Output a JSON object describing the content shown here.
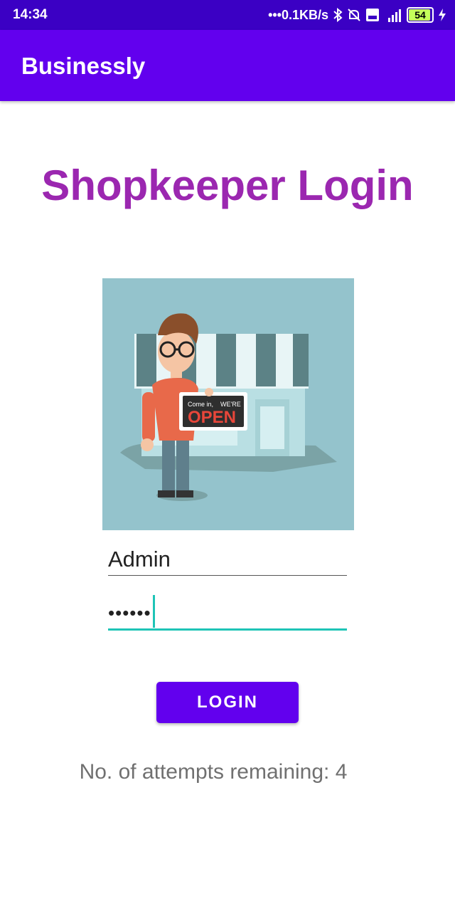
{
  "status_bar": {
    "time": "14:34",
    "network_speed": "•••0.1KB/s",
    "battery": "54",
    "icons": [
      "bluetooth-icon",
      "silent-icon",
      "volte-icon",
      "signal-4g-icon",
      "battery-icon",
      "charging-icon"
    ]
  },
  "app_bar": {
    "title": "Businessly"
  },
  "login": {
    "heading": "Shopkeeper Login",
    "illustration": {
      "sign_small_left": "Come in,",
      "sign_small_right": "WE'RE",
      "sign_big": "OPEN"
    },
    "username_value": "Admin",
    "password_dots": "••••••",
    "button_label": "LOGIN",
    "attempts_text": "No. of attempts remaining: 4"
  },
  "colors": {
    "status_bar": "#3b00c4",
    "app_bar": "#6200ee",
    "heading": "#9b27b0",
    "accent": "#1ec4b6",
    "button": "#6200ee"
  }
}
